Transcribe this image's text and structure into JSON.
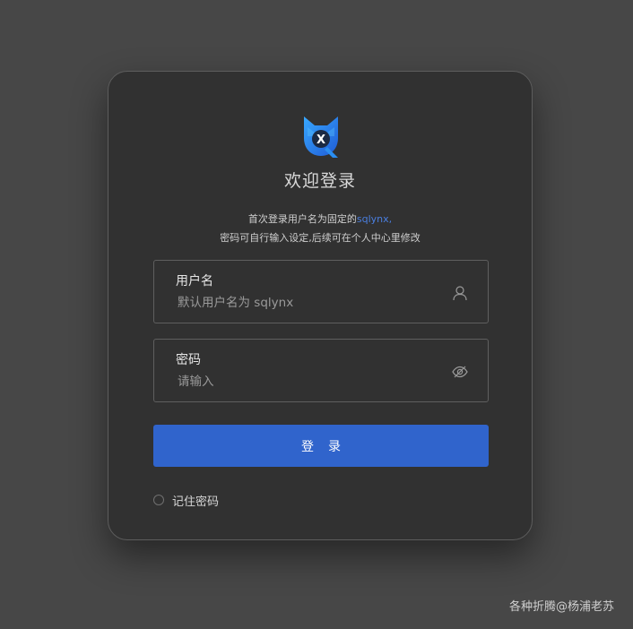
{
  "login": {
    "title": "欢迎登录",
    "description": {
      "line1_prefix": "首次登录用户名为固定的",
      "line1_highlight": "sqlynx,",
      "line2": "密码可自行输入设定,后续可在个人中心里修改"
    },
    "username": {
      "label": "用户名",
      "placeholder": "默认用户名为 sqlynx",
      "value": "",
      "icon": "user-icon"
    },
    "password": {
      "label": "密码",
      "placeholder": "请输入",
      "value": "",
      "icon": "eye-hidden-icon"
    },
    "submit_label": "登录",
    "remember_label": "记住密码",
    "remember_checked": false
  },
  "logo": {
    "icon": "sqlynx-logo",
    "letter": "X"
  },
  "watermark": "各种折腾@杨浦老苏",
  "colors": {
    "page_bg": "#474747",
    "card_bg": "#313131",
    "accent": "#3064cc",
    "highlight_text": "#4a7fe0"
  }
}
